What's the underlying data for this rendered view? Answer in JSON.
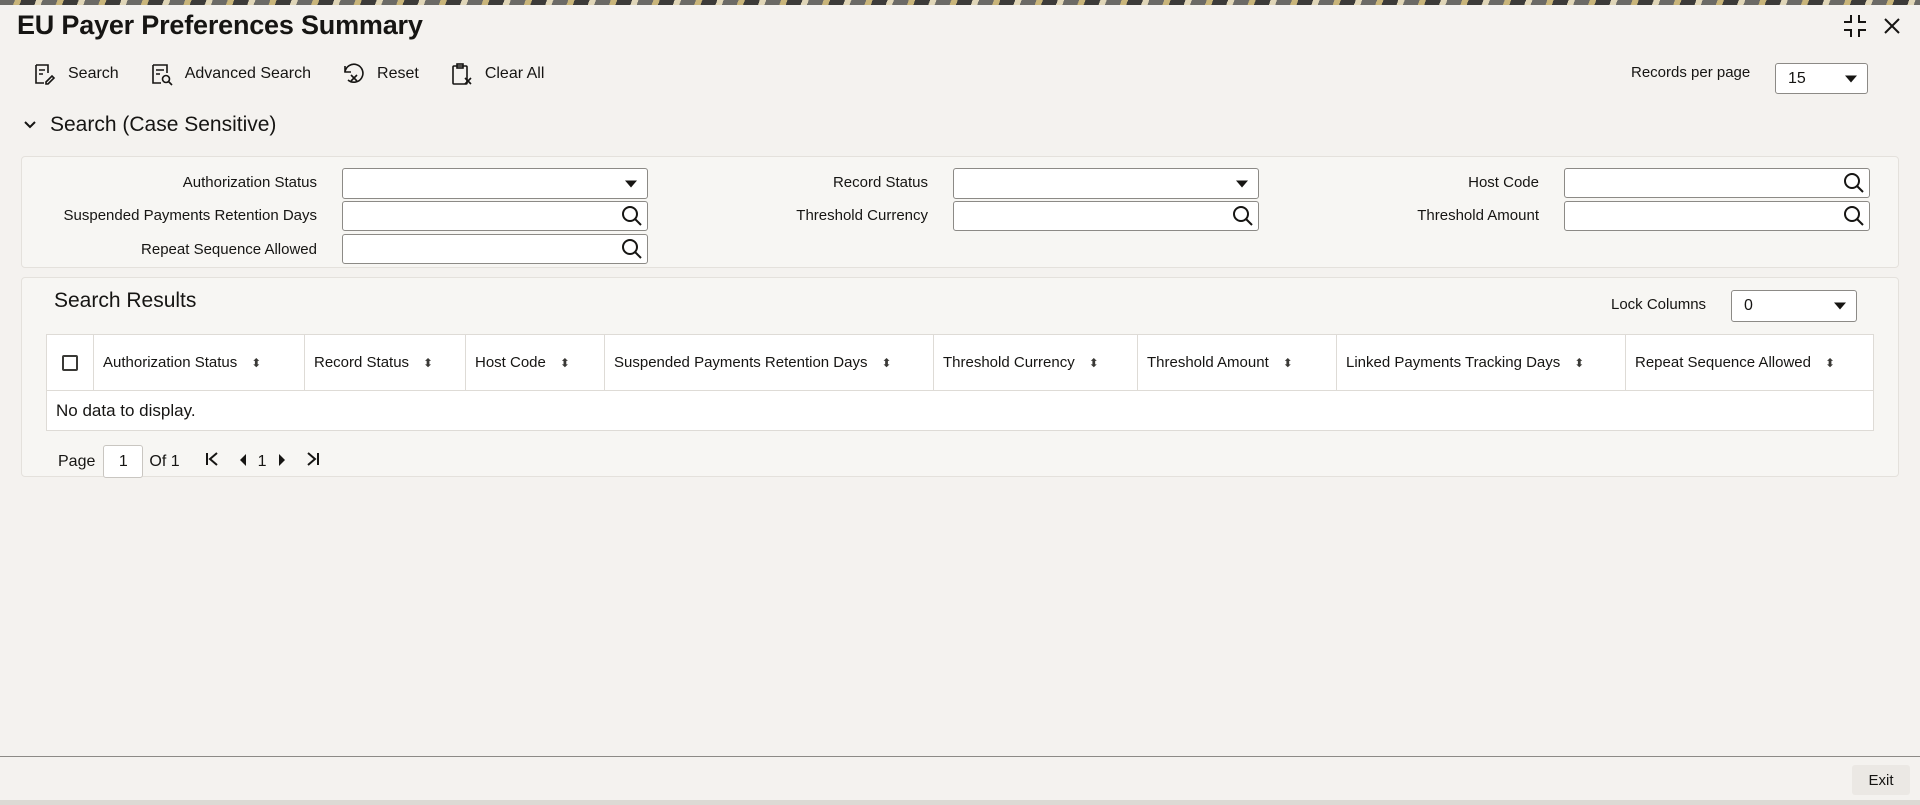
{
  "window": {
    "title": "EU Payer Preferences Summary",
    "maximize_icon": "compress-icon",
    "close_icon": "close-icon"
  },
  "toolbar": {
    "search": "Search",
    "advanced_search": "Advanced Search",
    "reset": "Reset",
    "clear_all": "Clear All",
    "records_per_page_label": "Records per page",
    "records_per_page_value": "15"
  },
  "search_section": {
    "title": "Search (Case Sensitive)",
    "fields": {
      "authorization_status": "Authorization Status",
      "record_status": "Record Status",
      "host_code": "Host Code",
      "suspended_payments_retention_days": "Suspended Payments Retention Days",
      "threshold_currency": "Threshold Currency",
      "threshold_amount": "Threshold Amount",
      "repeat_sequence_allowed": "Repeat Sequence Allowed"
    }
  },
  "results": {
    "title": "Search Results",
    "lock_columns_label": "Lock Columns",
    "lock_columns_value": "0",
    "columns": [
      "Authorization Status",
      "Record Status",
      "Host Code",
      "Suspended Payments Retention Days",
      "Threshold Currency",
      "Threshold Amount",
      "Linked Payments Tracking Days",
      "Repeat Sequence Allowed"
    ],
    "empty_message": "No data to display."
  },
  "pagination": {
    "page_label": "Page",
    "page_value": "1",
    "of_label": "Of 1",
    "current": "1"
  },
  "footer": {
    "exit": "Exit"
  }
}
